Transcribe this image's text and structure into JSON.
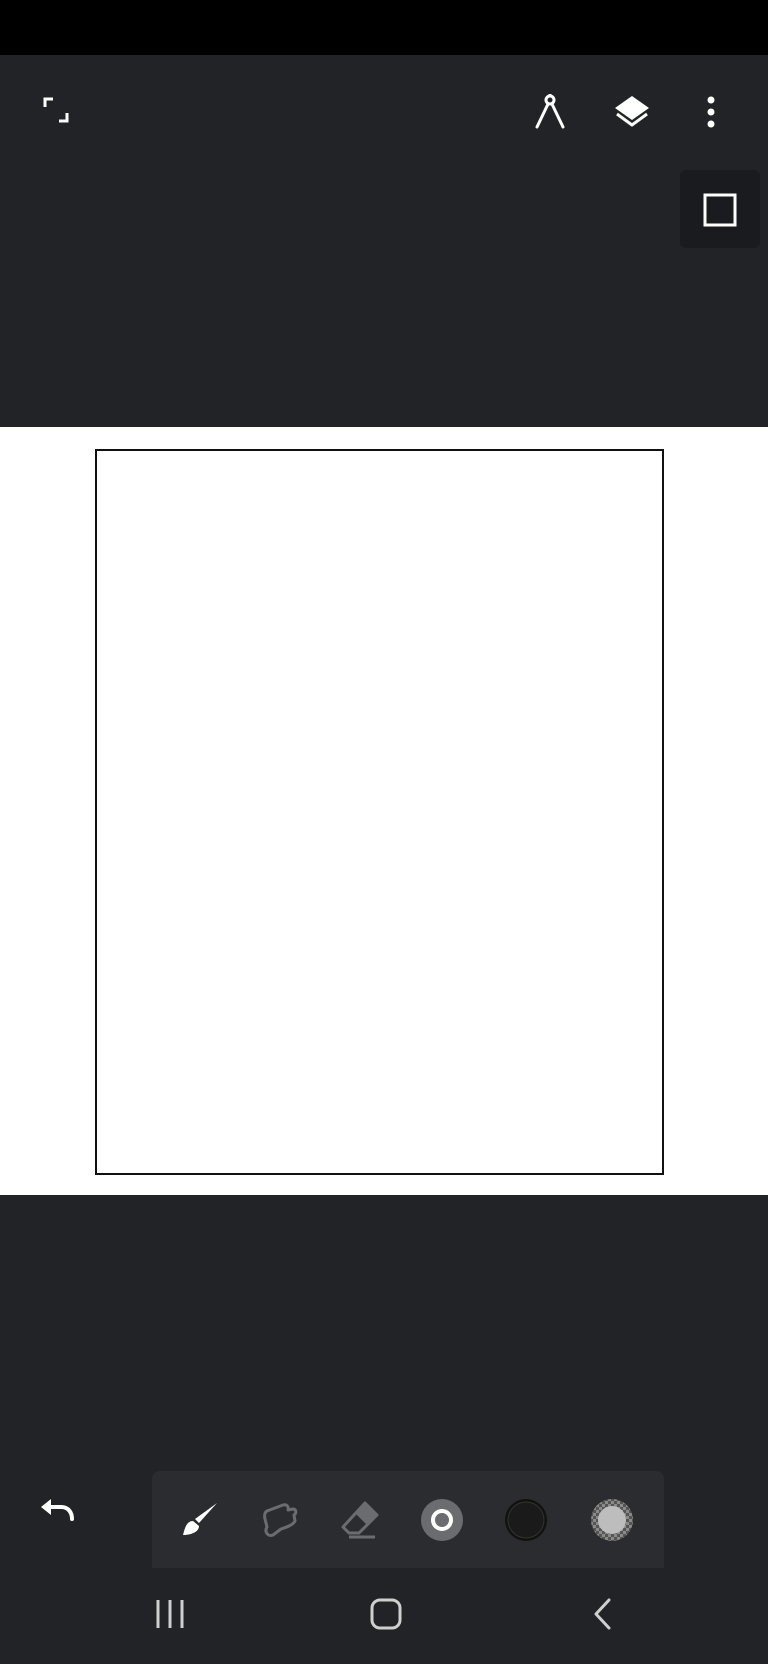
{
  "app": {
    "colors": {
      "background": "#222326",
      "canvas": "#ffffff",
      "icon": "#ffffff",
      "icon_dimmed": "#6b6c70",
      "toolbar": "#2b2c30"
    }
  },
  "top_bar": {
    "left_icons": [
      "fullscreen-icon"
    ],
    "right_icons": [
      "compass-icon",
      "layers-icon",
      "more-vert-icon"
    ]
  },
  "side_panel": {
    "icons": [
      "square-shape-icon"
    ]
  },
  "toolbar": {
    "tools": [
      {
        "icon": "brush-icon",
        "state": "selected"
      },
      {
        "icon": "smudge-icon",
        "state": "inactive"
      },
      {
        "icon": "eraser-icon",
        "state": "inactive"
      },
      {
        "icon": "brush-size-icon",
        "state": "normal"
      },
      {
        "icon": "color-swatch-icon",
        "color": "#1a1a1a"
      },
      {
        "icon": "opacity-icon",
        "state": "normal"
      }
    ],
    "undo_icon": "undo-icon"
  },
  "system_nav": {
    "icons": [
      "recents-icon",
      "home-icon",
      "back-icon"
    ]
  }
}
